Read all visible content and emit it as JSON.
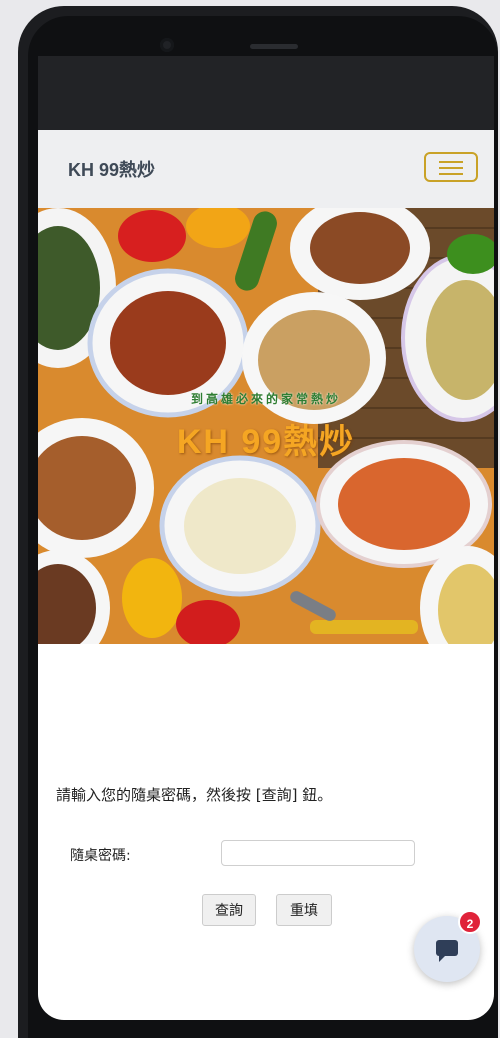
{
  "navbar": {
    "brand": "KH 99熱炒",
    "menu_icon": "hamburger-menu-icon"
  },
  "hero": {
    "tagline": "到高雄必來的家常熱炒",
    "title": "KH 99熱炒"
  },
  "form": {
    "instruction": "請輸入您的隨桌密碼，然後按 [查詢] 鈕。",
    "password_label": "隨桌密碼:",
    "password_value": "",
    "query_button": "查詢",
    "reset_button": "重填"
  },
  "chat": {
    "icon": "chat-bubble-icon",
    "badge_count": "2"
  },
  "colors": {
    "accent": "#c9a227",
    "brand_text": "#3f4a57",
    "badge": "#e0233a",
    "navbar_bg": "#eeeff1"
  }
}
